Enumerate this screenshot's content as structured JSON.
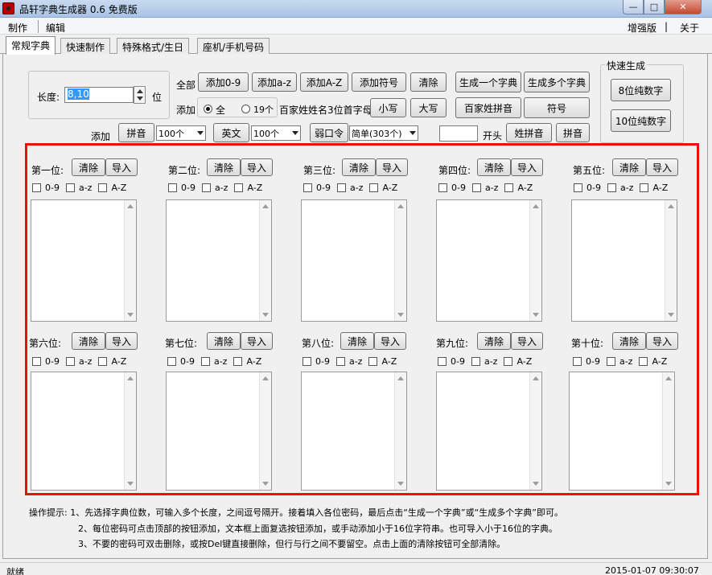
{
  "window": {
    "title": "品轩字典生成器 0.6 免费版",
    "min_glyph": "—",
    "max_glyph": "□",
    "close_glyph": "✕"
  },
  "menu": {
    "make": "制作",
    "edit": "编辑",
    "enhanced": "增强版",
    "sep": "|",
    "about": "关于"
  },
  "tabs": [
    "常规字典",
    "快速制作",
    "特殊格式/生日",
    "座机/手机号码"
  ],
  "length": {
    "label": "长度:",
    "value": "8,10",
    "unit": "位"
  },
  "row1": {
    "all_label": "全部",
    "add_09": "添加0-9",
    "add_az": "添加a-z",
    "add_AZ": "添加A-Z",
    "add_symbol": "添加符号",
    "clear": "清除",
    "gen_one": "生成一个字典",
    "gen_many": "生成多个字典"
  },
  "row2": {
    "add_label": "添加",
    "radio_all": "全",
    "radio_19": "19个",
    "surname_text": "百家姓姓名3位首字母",
    "lower": "小写",
    "upper": "大写",
    "surname_pinyin": "百家姓拼音",
    "symbol": "符号"
  },
  "row3": {
    "add_label": "添加",
    "pinyin": "拼音",
    "pinyin_count": "100个",
    "english": "英文",
    "english_count": "100个",
    "weak_pwd": "弱口令",
    "weak_mode": "简单(303个)",
    "prefix_value": "",
    "prefix_label": "开头",
    "name_pinyin": "姓拼音",
    "pinyin2": "拼音"
  },
  "quick": {
    "title": "快速生成",
    "btn8": "8位纯数字",
    "btn10": "10位纯数字"
  },
  "positions": [
    {
      "label": "第一位:",
      "clear": "清除",
      "import": "导入"
    },
    {
      "label": "第二位:",
      "clear": "清除",
      "import": "导入"
    },
    {
      "label": "第三位:",
      "clear": "清除",
      "import": "导入"
    },
    {
      "label": "第四位:",
      "clear": "清除",
      "import": "导入"
    },
    {
      "label": "第五位:",
      "clear": "清除",
      "import": "导入"
    },
    {
      "label": "第六位:",
      "clear": "清除",
      "import": "导入"
    },
    {
      "label": "第七位:",
      "clear": "清除",
      "import": "导入"
    },
    {
      "label": "第八位:",
      "clear": "清除",
      "import": "导入"
    },
    {
      "label": "第九位:",
      "clear": "清除",
      "import": "导入"
    },
    {
      "label": "第十位:",
      "clear": "清除",
      "import": "导入"
    }
  ],
  "checkbox_labels": {
    "digits": "0-9",
    "lower": "a-z",
    "upper": "A-Z"
  },
  "tips": {
    "line1": "操作提示: 1、先选择字典位数，可输入多个长度，之间逗号隔开。接着填入各位密码，最后点击“生成一个字典”或“生成多个字典”即可。",
    "line2": "2、每位密码可点击顶部的按钮添加，文本框上面复选按钮添加，或手动添加小于16位字符串。也可导入小于16位的字典。",
    "line3": "3、不要的密码可双击删除，或按Del键直接删除，但行与行之间不要留空。点击上面的清除按钮可全部清除。"
  },
  "status": {
    "left": "就绪",
    "right": "2015-01-07 09:30:07"
  },
  "colors": {
    "highlight_border": "#e81010",
    "selection": "#3399ff"
  }
}
